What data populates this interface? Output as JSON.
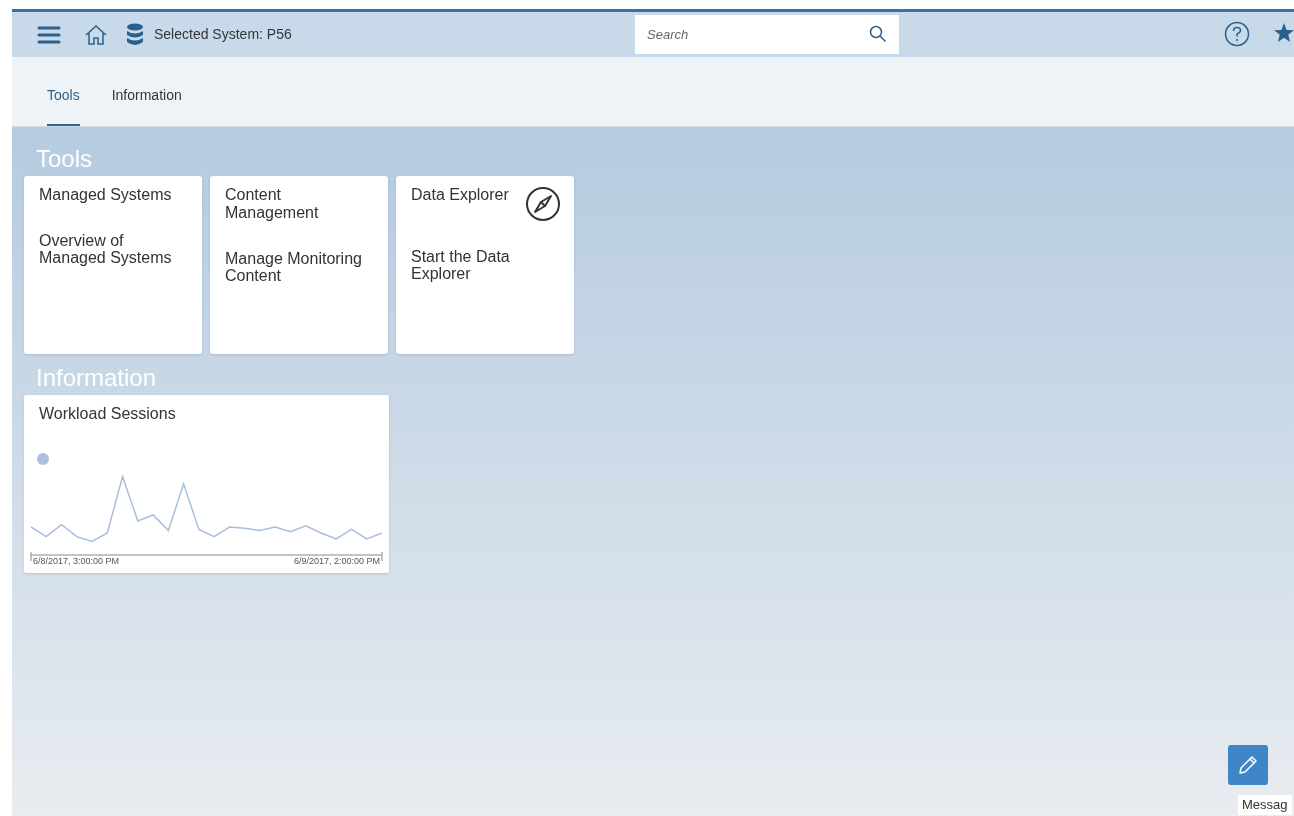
{
  "header": {
    "system_label": "Selected System: P56",
    "search": {
      "placeholder": "Search"
    }
  },
  "tabs": [
    {
      "label": "Tools",
      "selected": true
    },
    {
      "label": "Information",
      "selected": false
    }
  ],
  "sections": [
    {
      "title": "Tools",
      "tiles": [
        {
          "kind": "launch",
          "title": "Managed Systems",
          "subtitle": "Overview of Managed Systems",
          "icon": false
        },
        {
          "kind": "launch",
          "title": "Content Management",
          "subtitle": "Manage Monitoring Content",
          "icon": false
        },
        {
          "kind": "launch",
          "title": "Data Explorer",
          "subtitle": "Start the Data Explorer",
          "icon": true
        }
      ]
    },
    {
      "title": "Information",
      "tiles": [
        {
          "kind": "chart",
          "title": "Workload Sessions",
          "x_start": "6/8/2017, 3:00:00 PM",
          "x_end": "6/9/2017, 2:00:00 PM"
        }
      ]
    }
  ],
  "message_label": "Messag"
}
